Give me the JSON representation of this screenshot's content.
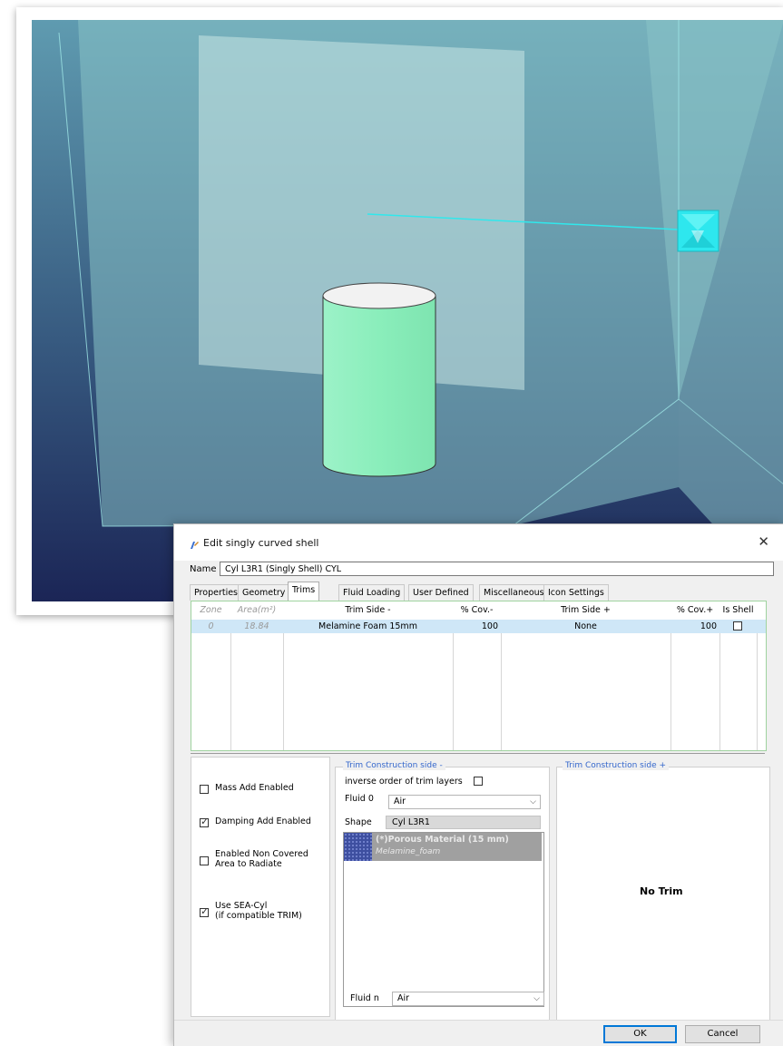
{
  "colors": {
    "accent": "#0078d7",
    "grid_border": "#9fd39f",
    "selected_row": "#cfe7f7",
    "group_title": "#3366cc",
    "cylinder": "#90f0c0",
    "source_cube": "#30f0f0"
  },
  "dialog": {
    "title": "Edit singly curved shell",
    "close_icon": "close-icon",
    "name_label": "Name",
    "name_value": "Cyl L3R1 (Singly Shell) CYL"
  },
  "tabs": [
    {
      "label": "Properties",
      "active": false
    },
    {
      "label": "Geometry",
      "active": false
    },
    {
      "label": "Trims",
      "active": true
    },
    {
      "label": "Fluid Loading",
      "active": false
    },
    {
      "label": "User Defined",
      "active": false
    },
    {
      "label": "Miscellaneous",
      "active": false
    },
    {
      "label": "Icon Settings",
      "active": false
    }
  ],
  "table": {
    "headers": {
      "zone": "Zone",
      "area": "Area(m²)",
      "trim_minus": "Trim Side -",
      "cov_minus": "% Cov.-",
      "trim_plus": "Trim Side +",
      "cov_plus": "% Cov.+",
      "is_shell": "Is Shell"
    },
    "rows": [
      {
        "zone": "0",
        "area": "18.84",
        "trim_minus": "Melamine Foam 15mm",
        "cov_minus": "100",
        "trim_plus": "None",
        "cov_plus": "100",
        "is_shell": false
      }
    ]
  },
  "options": {
    "mass_add": {
      "label": "Mass Add Enabled",
      "checked": false
    },
    "damping_add": {
      "label": "Damping Add Enabled",
      "checked": true
    },
    "non_covered": {
      "label_1": "Enabled Non Covered",
      "label_2": "Area to Radiate",
      "checked": false
    },
    "sea_cyl": {
      "label_1": "Use SEA-Cyl",
      "label_2": "(if compatible TRIM)",
      "checked": true
    }
  },
  "trim_minus": {
    "title": "Trim Construction side  -",
    "inverse_label": "inverse order of trim layers",
    "inverse_checked": false,
    "fluid0_label": "Fluid 0",
    "fluid0_value": "Air",
    "shape_label": "Shape",
    "shape_value": "Cyl L3R1",
    "layer": {
      "name": "(*)Porous Material (15 mm)",
      "material": "Melamine_foam"
    },
    "fluidn_label": "Fluid n",
    "fluidn_value": "Air"
  },
  "trim_plus": {
    "title": "Trim Construction side  +",
    "empty_text": "No Trim"
  },
  "buttons": {
    "ok": "OK",
    "cancel": "Cancel"
  }
}
